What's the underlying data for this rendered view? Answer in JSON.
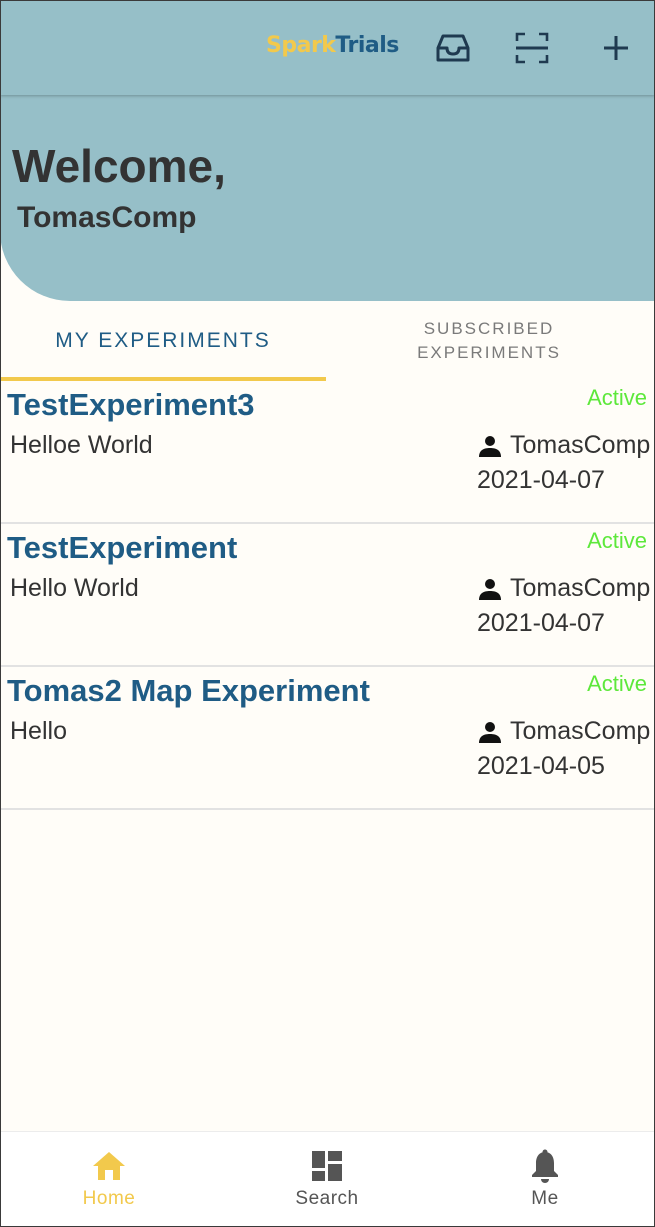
{
  "brand": {
    "part1": "Spark",
    "part2": "Trials"
  },
  "appbar": {
    "icons": [
      "inbox-icon",
      "qr-scan-icon",
      "add-icon"
    ]
  },
  "hero": {
    "greeting": "Welcome,",
    "username": "TomasComp"
  },
  "tabs": [
    {
      "label": "MY EXPERIMENTS",
      "active": true
    },
    {
      "label_line1": "SUBSCRIBED",
      "label_line2": "EXPERIMENTS",
      "active": false
    }
  ],
  "experiments": [
    {
      "title": "TestExperiment3",
      "description": "Helloe World",
      "status": "Active",
      "owner": "TomasComp",
      "date": "2021-04-07"
    },
    {
      "title": "TestExperiment",
      "description": "Hello World",
      "status": "Active",
      "owner": "TomasComp",
      "date": "2021-04-07"
    },
    {
      "title": "Tomas2 Map Experiment",
      "description": "Hello",
      "status": "Active",
      "owner": "TomasComp",
      "date": "2021-04-05"
    }
  ],
  "bottom_nav": [
    {
      "label": "Home",
      "icon": "home-icon",
      "active": true
    },
    {
      "label": "Search",
      "icon": "dashboard-icon",
      "active": false
    },
    {
      "label": "Me",
      "icon": "bell-icon",
      "active": false
    }
  ],
  "colors": {
    "header_bg": "#96bfc8",
    "brand_yellow": "#f2c94c",
    "brand_blue": "#1f5c85",
    "status_active": "#5de83b",
    "page_bg": "#fffdf8"
  }
}
